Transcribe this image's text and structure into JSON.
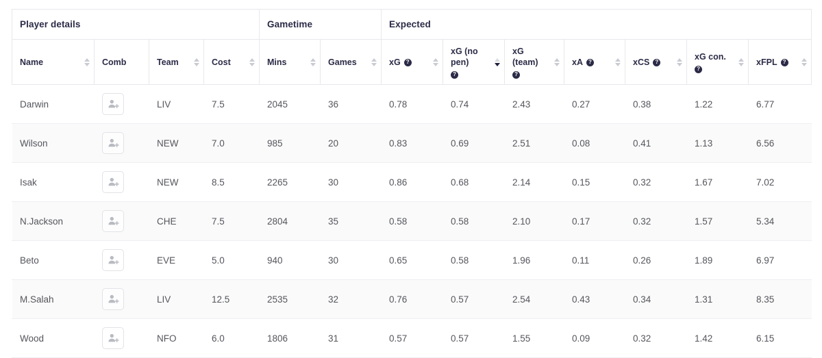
{
  "table": {
    "group_headers": [
      {
        "label": "Player details",
        "colspan": 4
      },
      {
        "label": "Gametime",
        "colspan": 2
      },
      {
        "label": "Expected",
        "colspan": 7
      }
    ],
    "columns": [
      {
        "key": "name",
        "label": "Name",
        "help": false,
        "sort": "none"
      },
      {
        "key": "comb",
        "label": "Comb",
        "help": false,
        "sort": "hidden"
      },
      {
        "key": "team",
        "label": "Team",
        "help": false,
        "sort": "none"
      },
      {
        "key": "cost",
        "label": "Cost",
        "help": false,
        "sort": "none"
      },
      {
        "key": "mins",
        "label": "Mins",
        "help": false,
        "sort": "none"
      },
      {
        "key": "games",
        "label": "Games",
        "help": false,
        "sort": "none"
      },
      {
        "key": "xg",
        "label": "xG",
        "help": true,
        "sort": "none"
      },
      {
        "key": "xg_nopen",
        "label": "xG (no pen)",
        "help": true,
        "sort": "desc"
      },
      {
        "key": "xg_team",
        "label": "xG (team)",
        "help": true,
        "sort": "none"
      },
      {
        "key": "xa",
        "label": "xA",
        "help": true,
        "sort": "none"
      },
      {
        "key": "xcs",
        "label": "xCS",
        "help": true,
        "sort": "none"
      },
      {
        "key": "xg_con",
        "label": "xG con.",
        "help": true,
        "sort": "none"
      },
      {
        "key": "xfpl",
        "label": "xFPL",
        "help": true,
        "sort": "none"
      }
    ],
    "help_glyph": "?",
    "comb_icon": "add-person-icon",
    "rows": [
      {
        "name": "Darwin",
        "comb": "add-person-icon",
        "team": "LIV",
        "cost": "7.5",
        "mins": "2045",
        "games": "36",
        "xg": "0.78",
        "xg_nopen": "0.74",
        "xg_team": "2.43",
        "xa": "0.27",
        "xcs": "0.38",
        "xg_con": "1.22",
        "xfpl": "6.77"
      },
      {
        "name": "Wilson",
        "comb": "add-person-icon",
        "team": "NEW",
        "cost": "7.0",
        "mins": "985",
        "games": "20",
        "xg": "0.83",
        "xg_nopen": "0.69",
        "xg_team": "2.51",
        "xa": "0.08",
        "xcs": "0.41",
        "xg_con": "1.13",
        "xfpl": "6.56"
      },
      {
        "name": "Isak",
        "comb": "add-person-icon",
        "team": "NEW",
        "cost": "8.5",
        "mins": "2265",
        "games": "30",
        "xg": "0.86",
        "xg_nopen": "0.68",
        "xg_team": "2.14",
        "xa": "0.15",
        "xcs": "0.32",
        "xg_con": "1.67",
        "xfpl": "7.02"
      },
      {
        "name": "N.Jackson",
        "comb": "add-person-icon",
        "team": "CHE",
        "cost": "7.5",
        "mins": "2804",
        "games": "35",
        "xg": "0.58",
        "xg_nopen": "0.58",
        "xg_team": "2.10",
        "xa": "0.17",
        "xcs": "0.32",
        "xg_con": "1.57",
        "xfpl": "5.34"
      },
      {
        "name": "Beto",
        "comb": "add-person-icon",
        "team": "EVE",
        "cost": "5.0",
        "mins": "940",
        "games": "30",
        "xg": "0.65",
        "xg_nopen": "0.58",
        "xg_team": "1.96",
        "xa": "0.11",
        "xcs": "0.26",
        "xg_con": "1.89",
        "xfpl": "6.97"
      },
      {
        "name": "M.Salah",
        "comb": "add-person-icon",
        "team": "LIV",
        "cost": "12.5",
        "mins": "2535",
        "games": "32",
        "xg": "0.76",
        "xg_nopen": "0.57",
        "xg_team": "2.54",
        "xa": "0.43",
        "xcs": "0.34",
        "xg_con": "1.31",
        "xfpl": "8.35"
      },
      {
        "name": "Wood",
        "comb": "add-person-icon",
        "team": "NFO",
        "cost": "6.0",
        "mins": "1806",
        "games": "31",
        "xg": "0.57",
        "xg_nopen": "0.57",
        "xg_team": "1.55",
        "xa": "0.09",
        "xcs": "0.32",
        "xg_con": "1.42",
        "xfpl": "6.15"
      }
    ]
  },
  "colors": {
    "header_text": "#2b2b47",
    "body_text": "#55565d",
    "border": "#e8e8ec",
    "row_stripe": "#fafafa",
    "sort_inactive": "#c9cbd3",
    "sort_active": "#1f1f3d"
  }
}
